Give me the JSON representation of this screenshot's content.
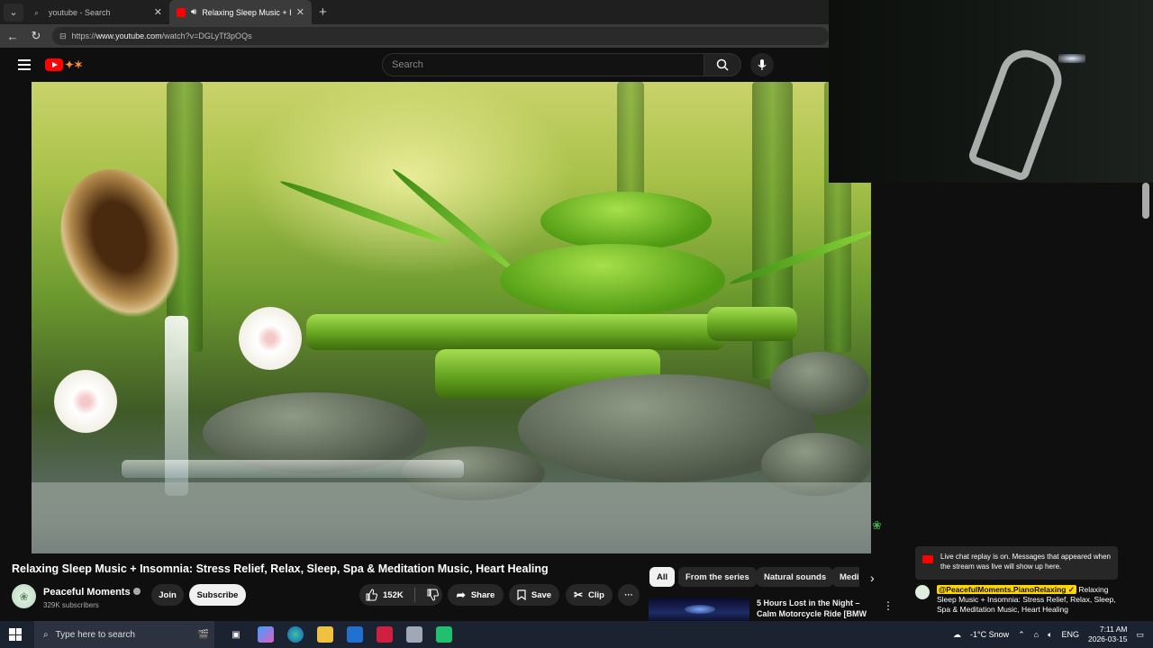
{
  "browser": {
    "tabs": [
      {
        "title": "youtube - Search",
        "active": false
      },
      {
        "title": "Relaxing Sleep Music + Insomnia",
        "active": true
      }
    ],
    "new_tab_icon": "+",
    "url_prefix": "https://",
    "url_domain": "www.youtube.com",
    "url_path": "/watch?v=DGLyTf3pOQs"
  },
  "youtube": {
    "search_placeholder": "Search",
    "video_title": "Relaxing Sleep Music + Insomnia: Stress Relief, Relax, Sleep, Spa & Meditation Music, Heart Healing",
    "channel": {
      "name": "Peaceful Moments",
      "subscribers": "329K subscribers"
    },
    "actions": {
      "join": "Join",
      "subscribe": "Subscribe",
      "likes": "152K",
      "share": "Share",
      "save": "Save",
      "clip": "Clip",
      "more": "···"
    },
    "chips": [
      "All",
      "From the series",
      "Natural sounds",
      "Medi"
    ],
    "recommendation": {
      "title": "5 Hours Lost in the Night – Calm Motorcycle Ride [BMW ..."
    }
  },
  "chat": {
    "notice": "Live chat replay is on. Messages that appeared when the stream was live will show up here.",
    "message_author": "@PeacefulMoments.PianoRelaxing ✓",
    "message_text": "Relaxing Sleep Music + Insomnia: Stress Relief, Relax, Sleep, Spa & Meditation Music, Heart Healing"
  },
  "taskbar": {
    "search_placeholder": "Type here to search",
    "weather": "-1°C  Snow",
    "language": "ENG",
    "time": "7:11 AM",
    "date": "2026-03-15"
  }
}
